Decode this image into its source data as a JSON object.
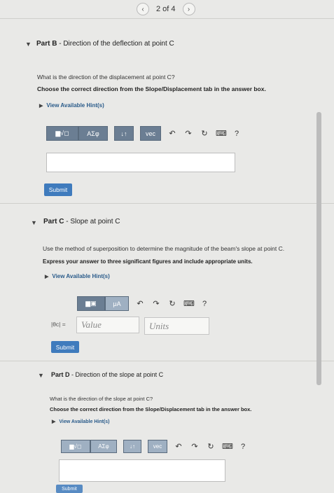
{
  "pager": {
    "text": "2 of 4",
    "prev_icon": "chevron-left-icon",
    "next_icon": "chevron-right-icon"
  },
  "part_b": {
    "label": "Part B",
    "title": " - Direction of the deflection at point C",
    "question": "What is the direction of the displacement at point C?",
    "instruction": "Choose the correct direction from the Slope/Displacement tab in the answer box.",
    "hint": "View Available Hint(s)",
    "toolbar": {
      "templates": "▆√◻",
      "symbols": "ΑΣφ",
      "arrows": "↓↑",
      "vec": "vec",
      "help": "?"
    },
    "submit": "Submit"
  },
  "part_c": {
    "label": "Part C",
    "title": " - Slope at point C",
    "question": "Use the method of superposition to determine the magnitude of the beam's slope at point C.",
    "instruction": "Express your answer to three significant figures and include appropriate units.",
    "hint": "View Available Hint(s)",
    "toolbar": {
      "templates": "▆▣",
      "units": "μA",
      "help": "?"
    },
    "var_label": "|θc| =",
    "value_placeholder": "Value",
    "units_placeholder": "Units",
    "submit": "Submit"
  },
  "part_d": {
    "label": "Part D",
    "title": " - Direction of the slope at point C",
    "question": "What is the direction of the slope at point C?",
    "instruction": "Choose the correct direction from the Slope/Displacement tab in the answer box.",
    "hint": "View Available Hint(s)",
    "toolbar": {
      "templates": "▆√◻",
      "symbols": "ΑΣφ",
      "arrows": "↓↑",
      "vec": "vec",
      "help": "?"
    },
    "submit": "Submit"
  }
}
